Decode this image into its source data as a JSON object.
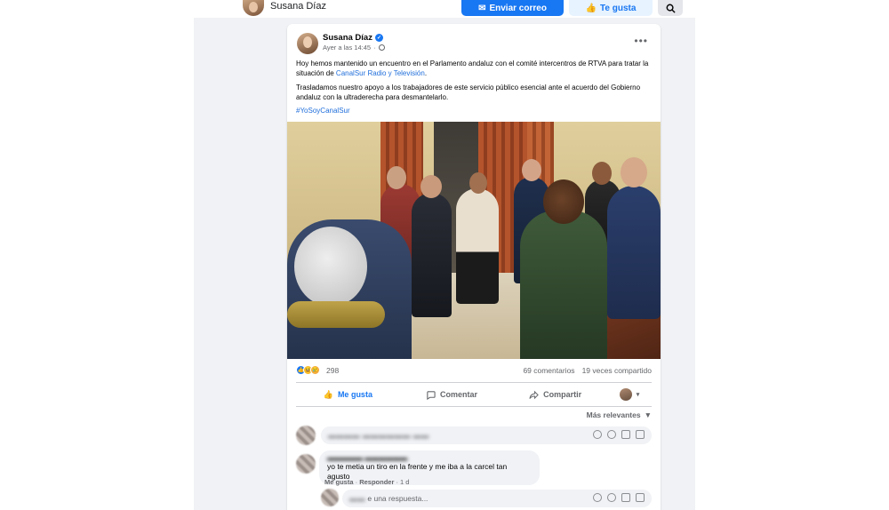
{
  "page_header": {
    "name": "Susana Díaz",
    "send_email_label": "Enviar correo",
    "like_page_label": "Te gusta"
  },
  "post": {
    "author": "Susana Díaz",
    "timestamp": "Ayer a las 14:45",
    "paragraph1_text": "Hoy hemos mantenido un encuentro en el Parlamento andaluz con el comité intercentros de RTVA para tratar la situación de ",
    "paragraph1_link": "CanalSur Radio y Televisión",
    "paragraph1_end": ".",
    "paragraph2": "Trasladamos nuestro apoyo a los trabajadores de este servicio público esencial ante el acuerdo del Gobierno andaluz con la ultraderecha para desmantelarlo.",
    "hashtag": "#YoSoyCanalSur",
    "reactions_count": "298",
    "comments_count": "69 comentarios",
    "shares_count": "19 veces compartido"
  },
  "actions": {
    "like": "Me gusta",
    "comment": "Comentar",
    "share": "Compartir"
  },
  "comments_section": {
    "sort_label": "Más relevantes",
    "comment": {
      "text": "yo te metia un tiro en la frente y me iba a la carcel tan agusto",
      "like_label": "Me gusta",
      "reply_label": "Responder",
      "age": "1 d"
    },
    "reply_placeholder": "e una respuesta..."
  },
  "colors": {
    "brand": "#1877f2",
    "link": "#216fdb"
  }
}
